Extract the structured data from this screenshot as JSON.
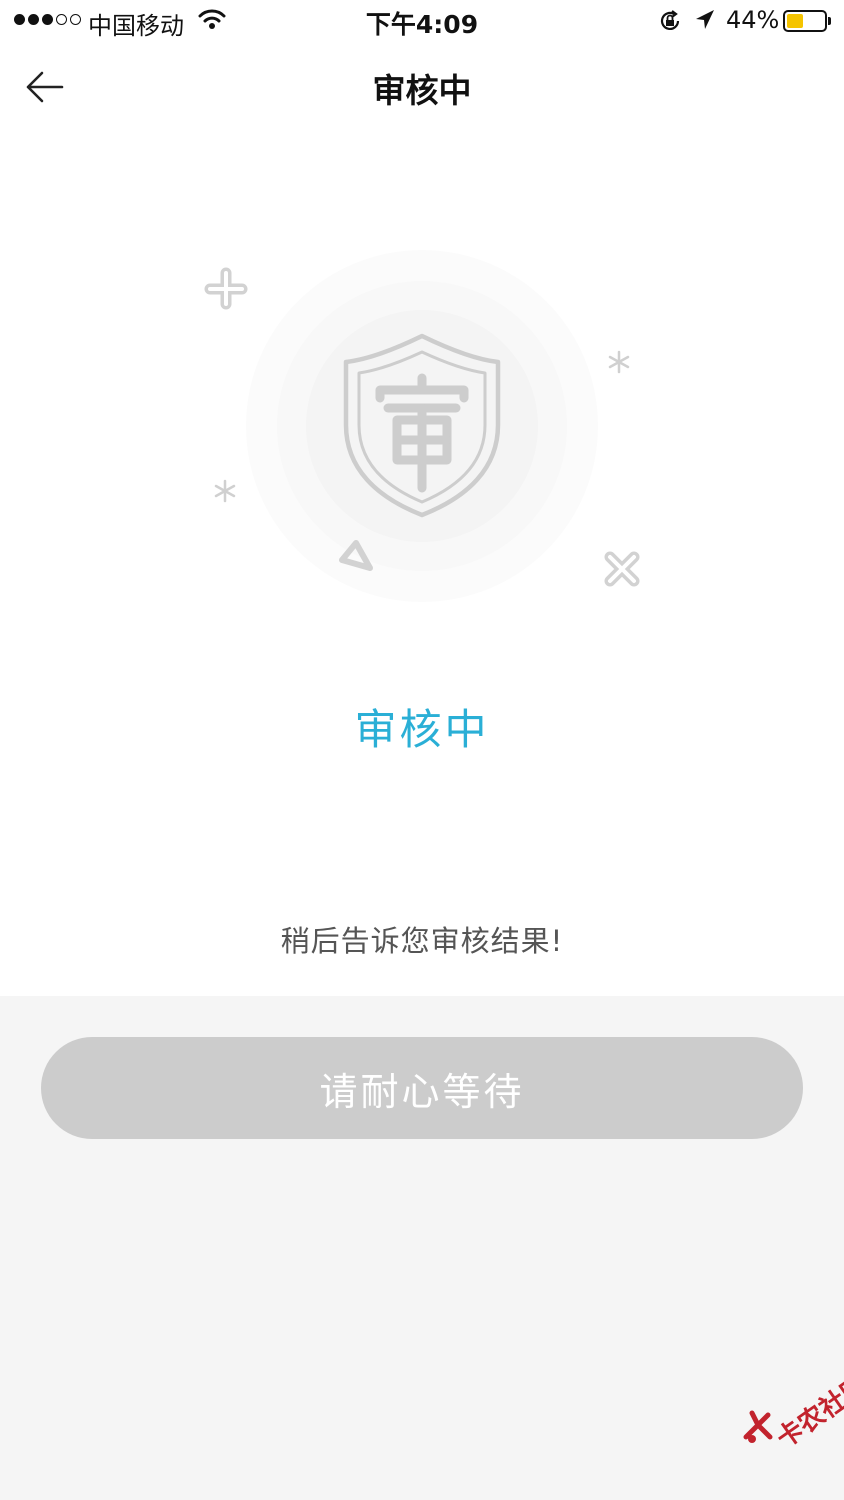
{
  "status_bar": {
    "carrier": "中国移动",
    "time": "下午4:09",
    "battery_percent": "44%",
    "battery_level": 0.44,
    "signal_bars_filled": 3,
    "signal_bars_total": 5
  },
  "nav": {
    "title": "审核中",
    "back_icon": "back-arrow-icon"
  },
  "illustration": {
    "icon": "shield-review-icon",
    "glyph": "审"
  },
  "main": {
    "status_label": "审核中",
    "hint": "稍后告诉您审核结果!"
  },
  "action": {
    "wait_label": "请耐心等待"
  },
  "watermark": {
    "text": "卡农社区"
  },
  "colors": {
    "accent": "#2aafd6",
    "button_disabled": "#cccccc",
    "battery": "#f5c400",
    "watermark": "#c2232d"
  }
}
